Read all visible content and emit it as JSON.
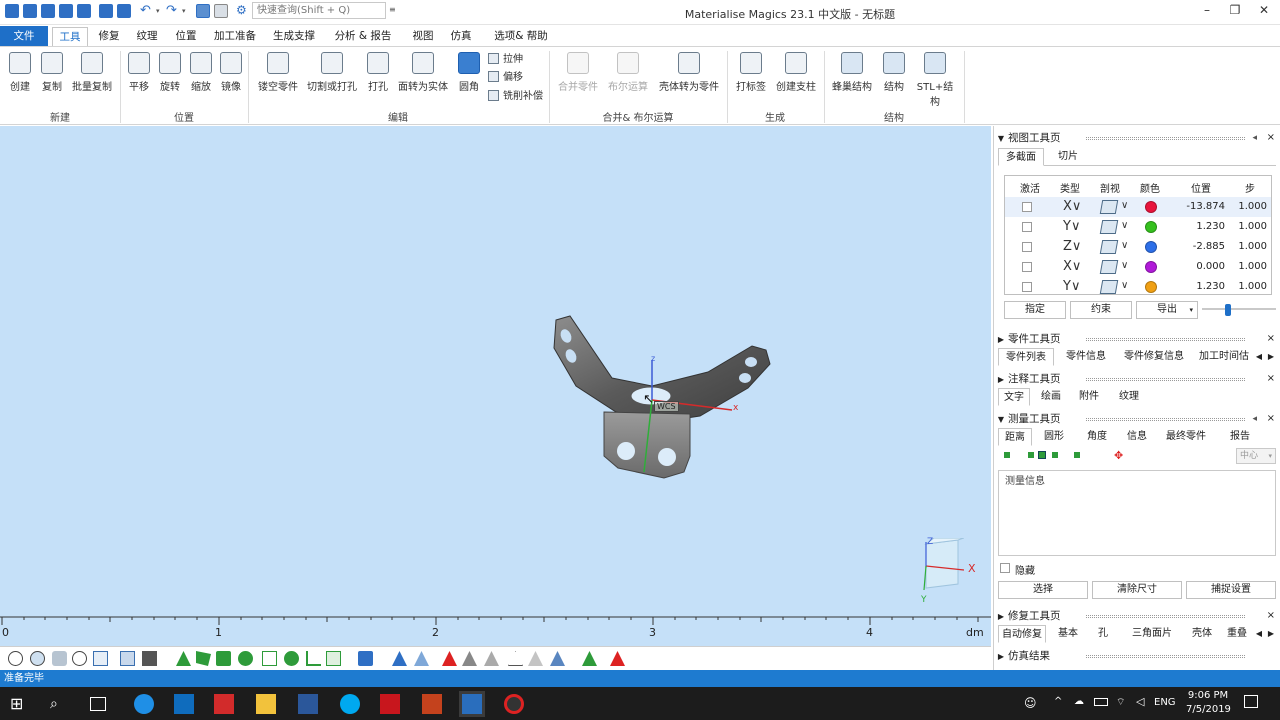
{
  "titlebar": {
    "app_title": "Materialise Magics 23.1 中文版 - 无标题",
    "search_placeholder": "快速查询(Shift + Q)"
  },
  "menu": {
    "file": "文件",
    "tabs": [
      "工具",
      "修复",
      "纹理",
      "位置",
      "加工准备",
      "生成支撑",
      "分析 & 报告",
      "视图",
      "仿真",
      "选项& 帮助"
    ],
    "active": "工具"
  },
  "ribbon": {
    "new_group": {
      "label": "新建",
      "buttons": [
        "创建",
        "复制",
        "批量复制"
      ]
    },
    "position_group": {
      "label": "位置",
      "buttons": [
        "平移",
        "旋转",
        "缩放",
        "镜像"
      ]
    },
    "edit_group": {
      "label": "编辑",
      "buttons": [
        "镂空零件",
        "切割或打孔",
        "打孔",
        "面转为实体",
        "圆角"
      ],
      "small": [
        "拉伸",
        "偏移",
        "铣削补偿"
      ]
    },
    "boolean_group": {
      "label": "合并& 布尔运算",
      "buttons": [
        "合并零件",
        "布尔运算",
        "壳体转为零件"
      ]
    },
    "generate_group": {
      "label": "生成",
      "buttons": [
        "打标签",
        "创建支柱"
      ]
    },
    "structure_group": {
      "label": "结构",
      "buttons": [
        "蜂巢结构",
        "结构",
        "STL+结构"
      ]
    }
  },
  "viewport": {
    "ruler_labels": [
      "0",
      "1",
      "2",
      "3",
      "4"
    ],
    "ruler_unit": "dm",
    "wcs_label": "WCS",
    "axis_x": "X",
    "axis_y": "Y",
    "axis_z": "Z",
    "part_axis_x": "x",
    "part_axis_z": "z",
    "background_color": "#c5e0f8"
  },
  "status": {
    "text": "准备完毕"
  },
  "view_toolpage": {
    "title": "视图工具页",
    "tabs": [
      "多截面",
      "切片"
    ],
    "headers": [
      "激活",
      "类型",
      "剖视",
      "颜色",
      "位置",
      "步"
    ],
    "rows": [
      {
        "axis": "X",
        "color": "#e8143c",
        "position": "-13.874",
        "step": "1.000"
      },
      {
        "axis": "Y",
        "color": "#35c01e",
        "position": "1.230",
        "step": "1.000"
      },
      {
        "axis": "Z",
        "color": "#2d6fe8",
        "position": "-2.885",
        "step": "1.000"
      },
      {
        "axis": "X",
        "color": "#b01ad8",
        "position": "0.000",
        "step": "1.000"
      },
      {
        "axis": "Y",
        "color": "#f0a014",
        "position": "1.230",
        "step": "1.000"
      }
    ],
    "buttons": [
      "指定",
      "约束",
      "导出"
    ]
  },
  "part_toolpage": {
    "title": "零件工具页",
    "tabs": [
      "零件列表",
      "零件信息",
      "零件修复信息",
      "加工时间估"
    ]
  },
  "annotation_toolpage": {
    "title": "注释工具页",
    "tabs": [
      "文字",
      "绘画",
      "附件",
      "纹理"
    ]
  },
  "measure_toolpage": {
    "title": "测量工具页",
    "tabs": [
      "距离",
      "圆形",
      "角度",
      "信息",
      "最终零件",
      "报告"
    ],
    "center_label": "中心",
    "info_label": "测量信息",
    "hide_label": "隐藏",
    "buttons": [
      "选择",
      "清除尺寸",
      "捕捉设置"
    ]
  },
  "repair_toolpage": {
    "title": "修复工具页",
    "tabs": [
      "自动修复",
      "基本",
      "孔",
      "三角面片",
      "壳体",
      "重叠"
    ]
  },
  "sim_results": {
    "title": "仿真结果"
  },
  "taskbar": {
    "language": "ENG",
    "time": "9:06 PM",
    "date": "7/5/2019"
  }
}
